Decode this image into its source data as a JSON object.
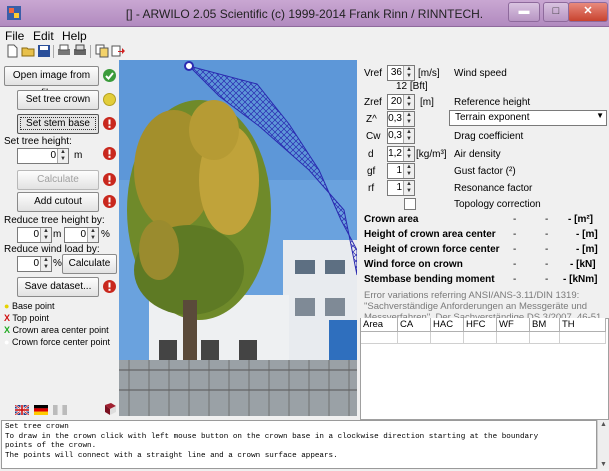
{
  "window": {
    "title": "[] - ARWILO 2.05 Scientific (c) 1999-2014 Frank Rinn / RINNTECH.",
    "minimize_glyph": "▬",
    "maximize_glyph": "□",
    "close_glyph": "✕"
  },
  "menu": {
    "items": [
      {
        "label": "File"
      },
      {
        "label": "Edit"
      },
      {
        "label": "Help"
      }
    ]
  },
  "toolbar": {
    "icons": [
      "new-document-icon",
      "open-folder-icon",
      "save-disk-icon",
      "print-icon",
      "print-preview-icon",
      "copy-icon",
      "export-icon"
    ]
  },
  "left_panel": {
    "open_image": "Open image from file...",
    "set_tree_crown": "Set tree crown",
    "set_stem_base": "Set stem base",
    "set_tree_height_label": "Set tree height:",
    "tree_height_value": "0",
    "tree_height_unit": "m",
    "calculate_1": "Calculate",
    "add_cutout": "Add cutout",
    "reduce_height_label": "Reduce tree height by:",
    "reduce_height_m_value": "0",
    "reduce_height_m_unit": "m",
    "reduce_height_pct_value": "0",
    "reduce_height_pct_unit": "%",
    "reduce_wind_label": "Reduce wind load by:",
    "reduce_wind_value": "0",
    "reduce_wind_unit": "%",
    "calculate_2": "Calculate",
    "save_dataset": "Save dataset...",
    "legend": [
      {
        "marker": "●",
        "label": "Base point",
        "color": "#e6d300"
      },
      {
        "marker": "X",
        "label": "Top point",
        "color": "#d01010"
      },
      {
        "marker": "X",
        "label": "Crown area center point",
        "color": "#1faa1f"
      },
      {
        "marker": "●",
        "label": "Crown force center point",
        "color": "#ffffff"
      }
    ]
  },
  "params": {
    "vref": {
      "label": "Vref",
      "value": "36",
      "unit": "[m/s]",
      "desc": "Wind speed",
      "sub": "12 [Bft]"
    },
    "zref": {
      "label": "Zref",
      "value": "20",
      "unit": "[m]",
      "desc": "Reference height"
    },
    "z": {
      "label": "Z^",
      "value": "0,3",
      "select": "Terrain exponent"
    },
    "cw": {
      "label": "Cw",
      "value": "0,3",
      "desc": "Drag coefficient"
    },
    "d": {
      "label": "d",
      "value": "1,2",
      "unit": "[kg/m³]",
      "desc": "Air density"
    },
    "gf": {
      "label": "gf",
      "value": "1",
      "desc": "Gust factor (²)"
    },
    "rf": {
      "label": "rf",
      "value": "1",
      "desc": "Resonance factor"
    },
    "topology": {
      "label": "Topology correction"
    }
  },
  "results": [
    {
      "label": "Crown area",
      "v1": "-",
      "v2": "-",
      "unit": "- [m²]"
    },
    {
      "label": "Height of crown area center",
      "v1": "-",
      "v2": "-",
      "unit": "- [m]"
    },
    {
      "label": "Height of crown force center",
      "v1": "-",
      "v2": "-",
      "unit": "- [m]"
    },
    {
      "label": "Wind force on crown",
      "v1": "-",
      "v2": "-",
      "unit": "- [kN]"
    },
    {
      "label": "Stembase bending moment",
      "v1": "-",
      "v2": "-",
      "unit": "- [kNm]"
    }
  ],
  "note": {
    "line1": "Error variations referring ANSI/ANS-3.11/DIN 1319:",
    "line2": "\"Sachverständige Anforderungen an Messgeräte und",
    "line3": "Messverfahren\". Der Sachverständige DS 3/2007,  46-51."
  },
  "table": {
    "columns": [
      "Area",
      "CA",
      "HAC",
      "HFC",
      "WF",
      "BM",
      "TH"
    ]
  },
  "log": {
    "lines": [
      "Set tree crown",
      "To draw in the crown click with left mouse button on the crown base in a clockwise direction starting at the boundary",
      "points of the crown.",
      "The points will connect with a straight line and a crown surface appears."
    ]
  },
  "colors": {
    "titlebar": "#b794c4",
    "ok": "#3b9b3b",
    "warn": "#e2cd3a",
    "error": "#c9281e",
    "crown_overlay": "#2a2ab0"
  }
}
